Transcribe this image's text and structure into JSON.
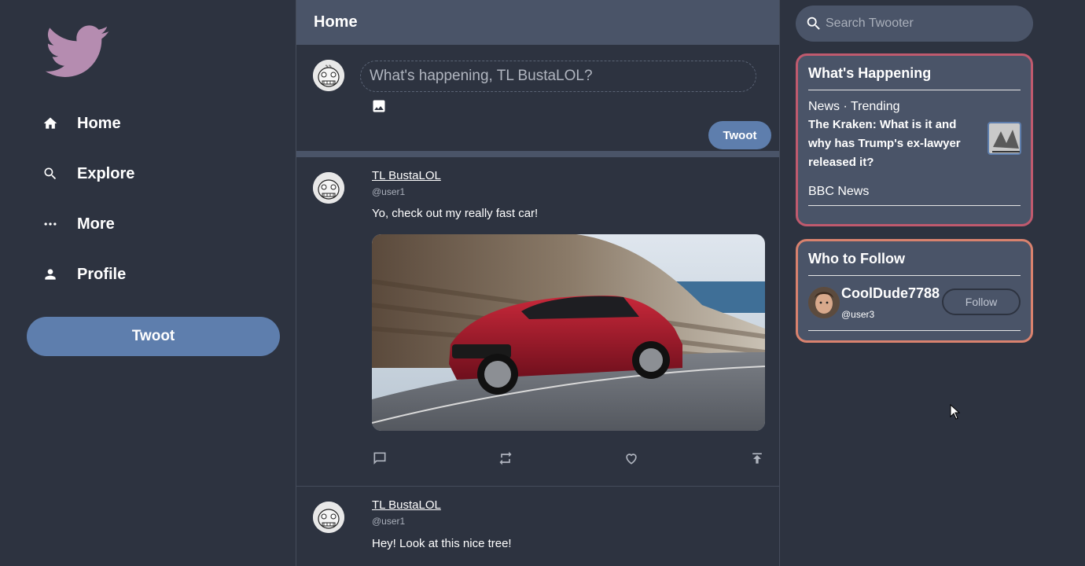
{
  "sidebar": {
    "nav": [
      {
        "label": "Home",
        "icon": "home-icon"
      },
      {
        "label": "Explore",
        "icon": "search-icon"
      },
      {
        "label": "More",
        "icon": "more-icon"
      },
      {
        "label": "Profile",
        "icon": "person-icon"
      }
    ],
    "tweet_button": "Twoot"
  },
  "header": {
    "title": "Home"
  },
  "compose": {
    "placeholder": "What's happening, TL BustaLOL?",
    "button": "Twoot"
  },
  "feed": [
    {
      "name": "TL BustaLOL",
      "handle": "@user1",
      "text": "Yo, check out my really fast car!"
    },
    {
      "name": "TL BustaLOL",
      "handle": "@user1",
      "text": "Hey! Look at this nice tree!"
    }
  ],
  "search": {
    "placeholder": "Search Twooter"
  },
  "happening": {
    "title": "What's Happening",
    "meta": "News · Trending",
    "headline": "The Kraken: What is it and why has Trump's ex-lawyer released it?",
    "source": "BBC News"
  },
  "who_to_follow": {
    "title": "Who to Follow",
    "name": "CoolDude7788",
    "handle": "@user3",
    "button": "Follow"
  },
  "colors": {
    "background": "#2d3340",
    "panel": "#4a5468",
    "accent": "#5e7ead",
    "logo": "#b58cb0",
    "happening_border": "#c05a6e",
    "follow_border": "#d9826e"
  }
}
